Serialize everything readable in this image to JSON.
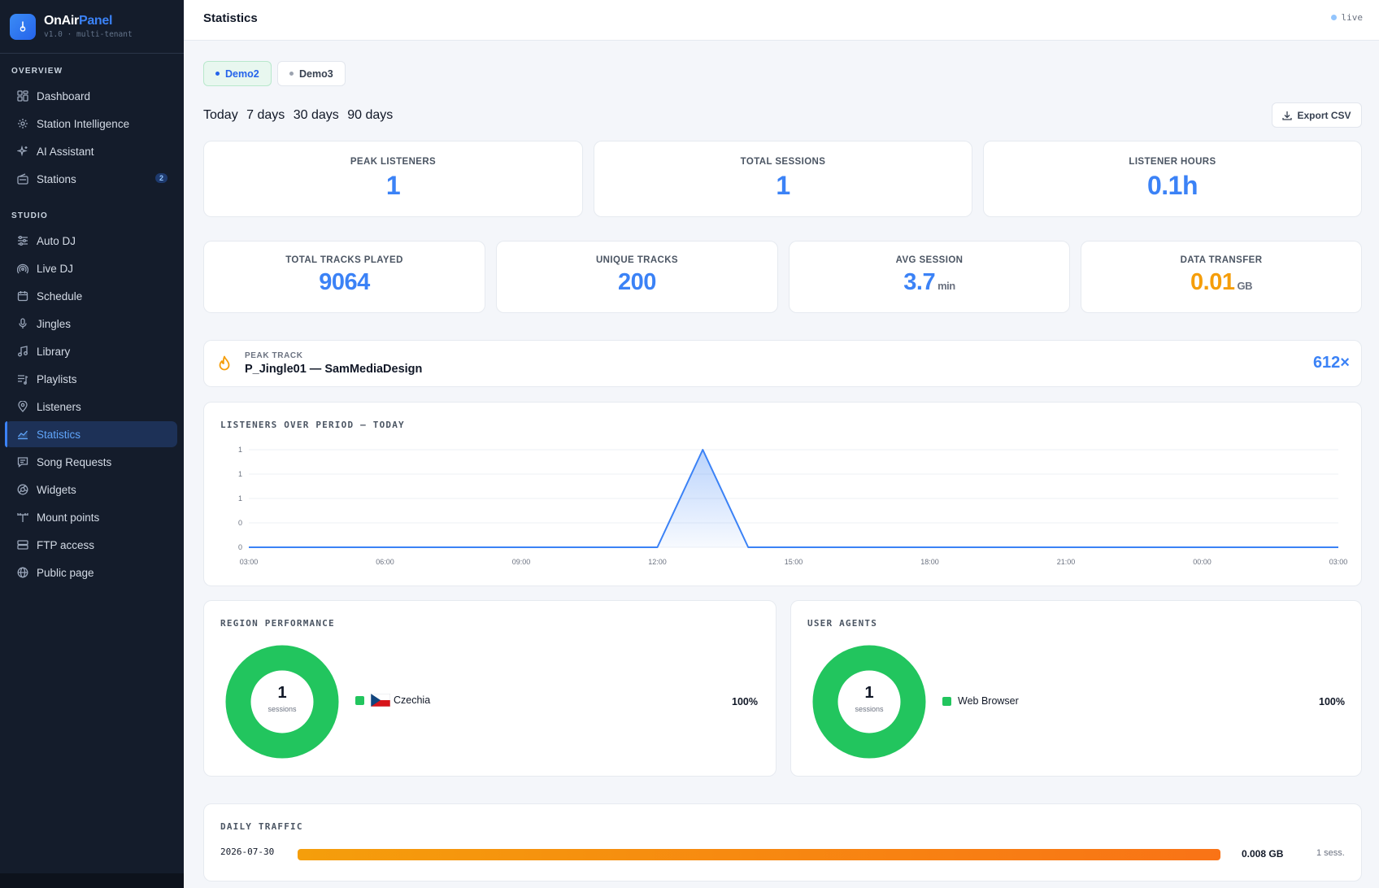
{
  "brand": {
    "name": "OnAir",
    "name_accent": "Panel",
    "subtitle": "v1.0 · multi-tenant"
  },
  "sidebar": {
    "sections": [
      {
        "label": "OVERVIEW",
        "items": [
          {
            "label": "Dashboard",
            "icon": "dashboard-icon"
          },
          {
            "label": "Station Intelligence",
            "icon": "brain-icon"
          },
          {
            "label": "AI Assistant",
            "icon": "sparkle-icon"
          },
          {
            "label": "Stations",
            "icon": "radio-icon",
            "badge": "2"
          }
        ]
      },
      {
        "label": "STUDIO",
        "items": [
          {
            "label": "Auto DJ",
            "icon": "sliders-icon"
          },
          {
            "label": "Live DJ",
            "icon": "broadcast-icon"
          },
          {
            "label": "Schedule",
            "icon": "calendar-icon"
          },
          {
            "label": "Jingles",
            "icon": "microphone-icon"
          },
          {
            "label": "Library",
            "icon": "music-note-icon"
          },
          {
            "label": "Playlists",
            "icon": "playlist-icon"
          },
          {
            "label": "Listeners",
            "icon": "map-pin-icon"
          },
          {
            "label": "Statistics",
            "icon": "chart-icon",
            "active": true
          },
          {
            "label": "Song Requests",
            "icon": "message-icon"
          },
          {
            "label": "Widgets",
            "icon": "widget-icon"
          },
          {
            "label": "Mount points",
            "icon": "antenna-icon"
          },
          {
            "label": "FTP access",
            "icon": "server-icon"
          },
          {
            "label": "Public page",
            "icon": "globe-icon"
          }
        ]
      }
    ]
  },
  "header": {
    "title": "Statistics",
    "status": "live"
  },
  "station_tabs": [
    {
      "label": "Demo2",
      "active": true
    },
    {
      "label": "Demo3",
      "active": false
    }
  ],
  "periods": [
    "Today",
    "7 days",
    "30 days",
    "90 days"
  ],
  "export_label": "Export CSV",
  "stats_top": [
    {
      "label": "PEAK LISTENERS",
      "value": "1"
    },
    {
      "label": "TOTAL SESSIONS",
      "value": "1"
    },
    {
      "label": "LISTENER HOURS",
      "value": "0.1h"
    }
  ],
  "stats_bottom": [
    {
      "label": "TOTAL TRACKS PLAYED",
      "value": "9064",
      "unit": ""
    },
    {
      "label": "UNIQUE TRACKS",
      "value": "200",
      "unit": ""
    },
    {
      "label": "AVG SESSION",
      "value": "3.7",
      "unit": "min"
    },
    {
      "label": "DATA TRANSFER",
      "value": "0.01",
      "unit": "GB"
    }
  ],
  "peak": {
    "label": "PEAK TRACK",
    "track": "P_Jingle01 — SamMediaDesign",
    "count": "612×"
  },
  "chart_data": {
    "type": "area",
    "title": "LISTENERS OVER PERIOD — TODAY",
    "x": [
      "03:00",
      "04:00",
      "05:00",
      "06:00",
      "07:00",
      "08:00",
      "09:00",
      "10:00",
      "11:00",
      "12:00",
      "13:00",
      "14:00",
      "15:00",
      "16:00",
      "17:00",
      "18:00",
      "19:00",
      "20:00",
      "21:00",
      "22:00",
      "23:00",
      "00:00",
      "01:00",
      "02:00",
      "03:00"
    ],
    "series": [
      {
        "values": [
          0,
          0,
          0,
          0,
          0,
          0,
          0,
          0,
          0,
          0,
          1,
          0,
          0,
          0,
          0,
          0,
          0,
          0,
          0,
          0,
          0,
          0,
          0,
          0,
          0
        ]
      }
    ],
    "x_tick_labels": [
      "03:00",
      "06:00",
      "09:00",
      "12:00",
      "15:00",
      "18:00",
      "21:00",
      "00:00",
      "03:00"
    ],
    "y_tick_labels": [
      "1",
      "1",
      "1",
      "0",
      "0"
    ],
    "ylim": [
      0,
      1
    ],
    "grid": true,
    "color": "#3b82f6"
  },
  "region": {
    "title": "REGION PERFORMANCE",
    "total": "1",
    "total_label": "sessions",
    "items": [
      {
        "label": "Czechia",
        "flag": "czech-flag-icon",
        "pct": "100%",
        "color": "#22c55e"
      }
    ]
  },
  "agents": {
    "title": "USER AGENTS",
    "total": "1",
    "total_label": "sessions",
    "items": [
      {
        "label": "Web Browser",
        "pct": "100%",
        "color": "#22c55e"
      }
    ]
  },
  "traffic": {
    "title": "DAILY TRAFFIC",
    "rows": [
      {
        "date": "2026-07-30",
        "gb": "0.008 GB",
        "sessions": "1 sess.",
        "fraction": 1.0
      }
    ]
  }
}
